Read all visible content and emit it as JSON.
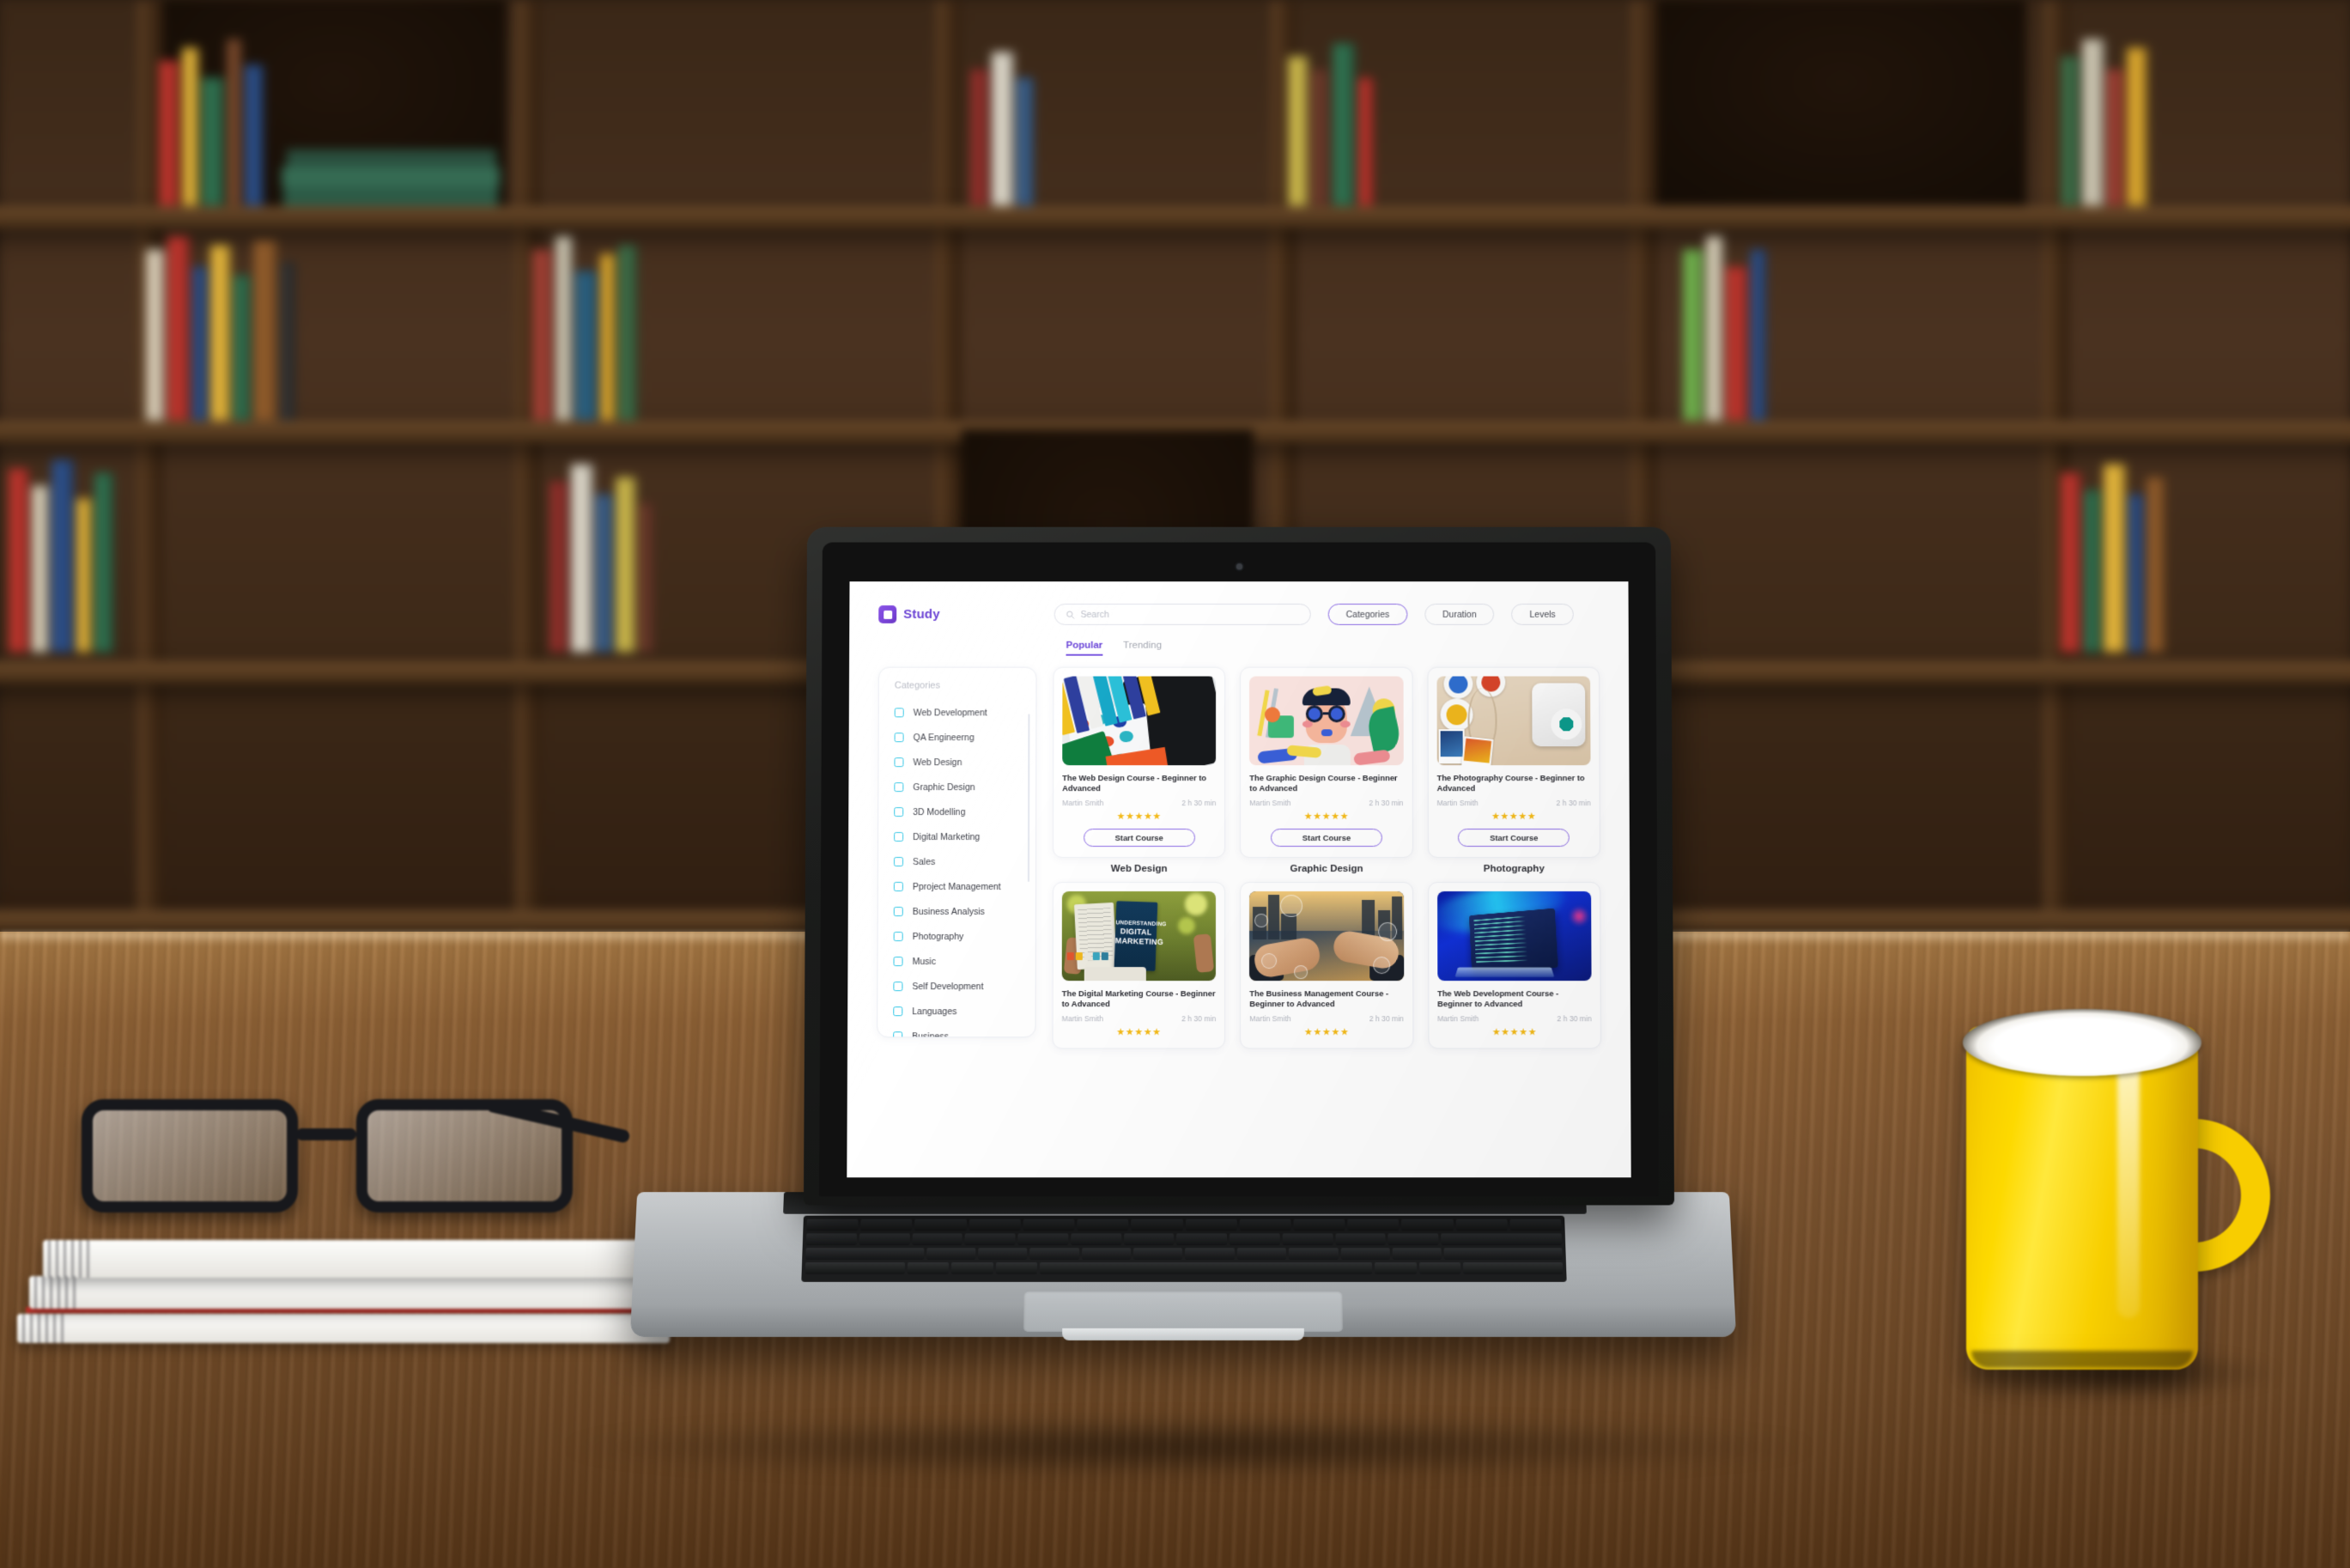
{
  "app": {
    "brand_name": "Study",
    "logo_icon": "study-logo-mark"
  },
  "search": {
    "placeholder": "Search",
    "value": "",
    "icon": "search-icon"
  },
  "filters": [
    {
      "label": "Categories",
      "active": true
    },
    {
      "label": "Duration",
      "active": false
    },
    {
      "label": "Levels",
      "active": false
    }
  ],
  "tabs": [
    {
      "label": "Popular",
      "active": true
    },
    {
      "label": "Trending",
      "active": false
    }
  ],
  "sidebar": {
    "title": "Categories",
    "items": [
      {
        "label": "Web Development",
        "checked": false
      },
      {
        "label": "QA Engineerng",
        "checked": false
      },
      {
        "label": "Web Design",
        "checked": false
      },
      {
        "label": "Graphic Design",
        "checked": false
      },
      {
        "label": "3D Modelling",
        "checked": false
      },
      {
        "label": "Digital Marketing",
        "checked": false
      },
      {
        "label": "Sales",
        "checked": false
      },
      {
        "label": "Pproject Management",
        "checked": false
      },
      {
        "label": "Business Analysis",
        "checked": false
      },
      {
        "label": "Photography",
        "checked": false
      },
      {
        "label": "Music",
        "checked": false
      },
      {
        "label": "Self Development",
        "checked": false
      },
      {
        "label": "Languages",
        "checked": false
      },
      {
        "label": "Business",
        "checked": false
      }
    ]
  },
  "courses": {
    "button_label": "Start Course",
    "row1": [
      {
        "title": "The Web Design Course - Beginner to Advanced",
        "author": "Martin Smith",
        "duration": "2 h 30 min",
        "stars": "★★★★★",
        "category_label": "Web Design",
        "thumb": "color-swatches-tablet"
      },
      {
        "title": "The Graphic Design Course - Beginner to Advanced",
        "author": "Martin Smith",
        "duration": "2 h 30 min",
        "stars": "★★★★★",
        "category_label": "Graphic Design",
        "thumb": "illustrated-portrait"
      },
      {
        "title": "The  Photography Course - Beginner to Advanced",
        "author": "Martin Smith",
        "duration": "2 h 30 min",
        "stars": "★★★★★",
        "category_label": "Photography",
        "thumb": "instant-camera-paints"
      }
    ],
    "row2": [
      {
        "title": "The  Digital Marketing Course - Beginner to Advanced",
        "author": "Martin Smith",
        "duration": "2 h 30 min",
        "stars": "★★★★★",
        "thumb": "digital-marketing-book"
      },
      {
        "title": "The Business Management Course - Beginner to Advanced",
        "author": "Martin Smith",
        "duration": "2 h 30 min",
        "stars": "★★★★★",
        "thumb": "handshake-city"
      },
      {
        "title": "The Web Development Course - Beginner to Advanced",
        "author": "Martin Smith",
        "duration": "2 h 30 min",
        "stars": "★★★★★",
        "thumb": "laptop-code-blue"
      }
    ]
  },
  "colors": {
    "brand_purple": "#5b2fd0",
    "accent_purple": "#8c6ce6",
    "checkbox_cyan": "#2ec6e6",
    "star_yellow": "#f5bb18",
    "muted_text": "#b4b7c1"
  }
}
